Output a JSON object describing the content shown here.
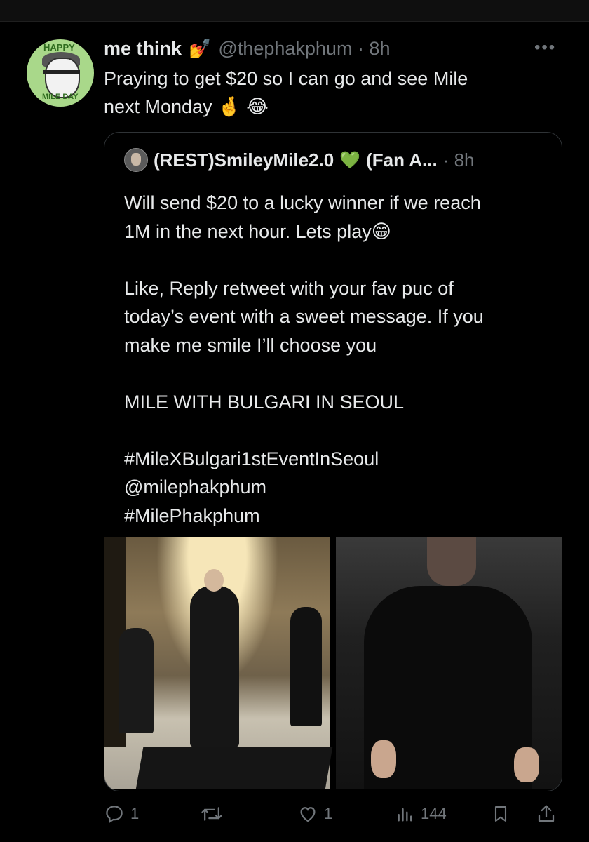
{
  "tweet": {
    "author_name": "me think",
    "author_emoji": "💅",
    "handle_time": "@thephakphum · 8h",
    "avatar_text_top": "HAPPY",
    "avatar_text_bottom": "MILE DAY",
    "text_lines": [
      "Praying to get $20 so I can go and see Mile",
      "next Monday 🤞 😂"
    ]
  },
  "quote": {
    "name": "(REST)SmileyMile2.0",
    "heart": "💚",
    "name_suffix": "(Fan A...",
    "time": "· 8h",
    "text_lines": [
      "Will send $20 to a lucky winner if we reach",
      "1M in the next hour. Lets play😁",
      "",
      "Like, Reply  retweet with your fav puc of",
      "today’s event with a sweet message. If you",
      "make me smile I’ll choose you",
      "",
      "MILE WITH BULGARI IN SEOUL",
      "",
      "#MileXBulgari1stEventInSeoul",
      "@milephakphum",
      "#MilePhakphum"
    ]
  },
  "actions": {
    "reply_count": "1",
    "retweet_count": "",
    "like_count": "1",
    "views_count": "144"
  },
  "colors": {
    "background": "#000000",
    "text": "#e7e9ea",
    "muted": "#71767b",
    "border": "#2f3336"
  }
}
